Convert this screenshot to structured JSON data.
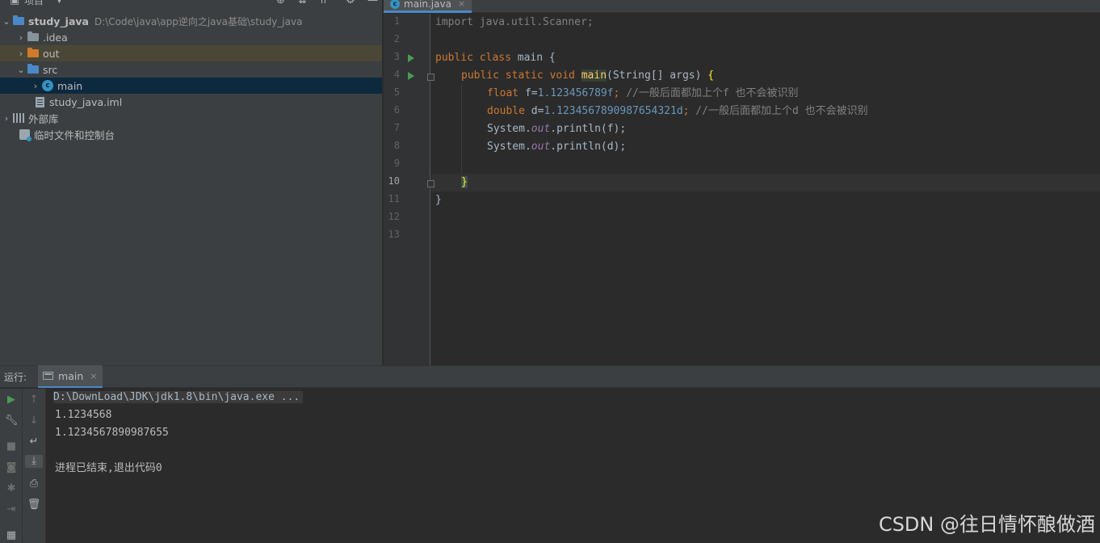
{
  "project_panel": {
    "title": "项目",
    "toolbar_icons": [
      "locate-icon",
      "expand-all-icon",
      "collapse-all-icon",
      "gear-icon",
      "minimize-icon"
    ],
    "tree": [
      {
        "label": "study_java",
        "path": "D:\\Code\\java\\app逆向之java基础\\study_java",
        "icon": "module-folder-icon",
        "expanded": true
      },
      {
        "label": ".idea",
        "icon": "folder-icon",
        "expanded": false
      },
      {
        "label": "out",
        "icon": "excluded-folder-icon",
        "expanded": false
      },
      {
        "label": "src",
        "icon": "source-folder-icon",
        "expanded": true
      },
      {
        "label": "main",
        "icon": "java-class-icon",
        "expanded": false
      },
      {
        "label": "study_java.iml",
        "icon": "iml-file-icon"
      },
      {
        "label": "外部库",
        "icon": "library-icon",
        "expanded": false
      },
      {
        "label": "临时文件和控制台",
        "icon": "scratch-icon"
      }
    ]
  },
  "editor": {
    "tab_label": "main.java",
    "tab_close": "×",
    "class_badge": "c",
    "line_numbers": [
      "1",
      "2",
      "3",
      "4",
      "5",
      "6",
      "7",
      "8",
      "9",
      "10",
      "11",
      "12",
      "13"
    ],
    "current_line": "10",
    "code": {
      "l1": "import java.util.Scanner;",
      "l3_kw": "public class",
      "l3_rest": " main {",
      "l4_kw": "public static void",
      "l4_method": "main",
      "l4_rest": "(String[] args) ",
      "l4_brace": "{",
      "l5_kw": "float",
      "l5_a": " f=",
      "l5_num": "1.123456789f",
      "l5_b": "; ",
      "l5_cmt": "//一般后面都加上个f 也不会被识别",
      "l6_kw": "double",
      "l6_a": " d=",
      "l6_num": "1.1234567890987654321d",
      "l6_b": "; ",
      "l6_cmt": "//一般后面都加上个d 也不会被识别",
      "l7_a": "System.",
      "l7_fld": "out",
      "l7_b": ".println(f);",
      "l8_a": "System.",
      "l8_fld": "out",
      "l8_b": ".println(d);",
      "l10": "}",
      "l11": "}"
    }
  },
  "run_panel": {
    "label": "运行:",
    "tab_label": "main",
    "tab_close": "×",
    "console": {
      "command": "D:\\DownLoad\\JDK\\jdk1.8\\bin\\java.exe ...",
      "out1": "1.1234568",
      "out2": "1.1234567890987655",
      "exit": "进程已结束,退出代码0"
    }
  },
  "watermark": "CSDN @往日情怀酿做酒",
  "colors": {
    "keyword": "#cc7832",
    "number": "#6897bb",
    "comment": "#808080",
    "field": "#9876aa",
    "method": "#ffc66d",
    "run_green": "#499c54",
    "selection": "#0d293e"
  }
}
